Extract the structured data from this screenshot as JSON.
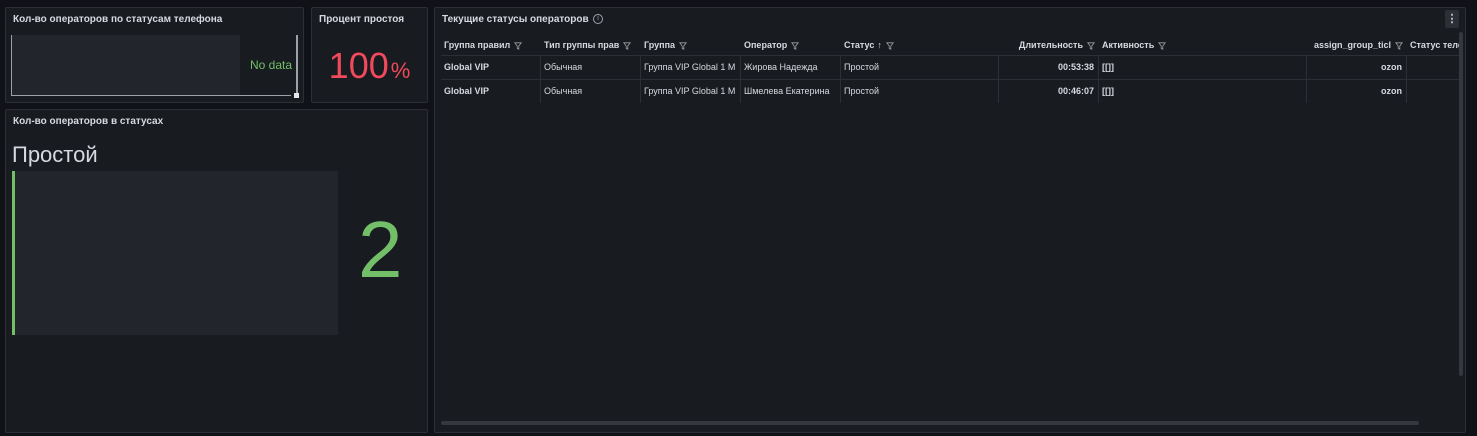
{
  "panels": {
    "phone_status": {
      "title": "Кол-во операторов по статусам телефона",
      "no_data": "No data"
    },
    "idle_percent": {
      "title": "Процент простоя",
      "value": "100",
      "unit": "%",
      "color": "#f2495c"
    },
    "operators_in_status": {
      "title": "Кол-во операторов в статусах",
      "label": "Простой",
      "value": "2",
      "color": "#73bf69"
    },
    "current_statuses": {
      "title": "Текущие статусы операторов",
      "columns": [
        "Группа правил",
        "Тип группы прав",
        "Группа",
        "Оператор",
        "Статус",
        "Длительность",
        "Активность",
        "assign_group_ticl",
        "Статус теле"
      ],
      "sort_indicator": "↑",
      "rows": [
        [
          "Global VIP",
          "Обычная",
          "Группа VIP Global 1 М",
          "Жирова Надежда",
          "Простой",
          "00:53:38",
          "[[]]",
          "ozon",
          ""
        ],
        [
          "Global VIP",
          "Обычная",
          "Группа VIP Global 1 М",
          "Шмелева Екатерина",
          "Простой",
          "00:46:07",
          "[[]]",
          "ozon",
          ""
        ]
      ]
    }
  }
}
